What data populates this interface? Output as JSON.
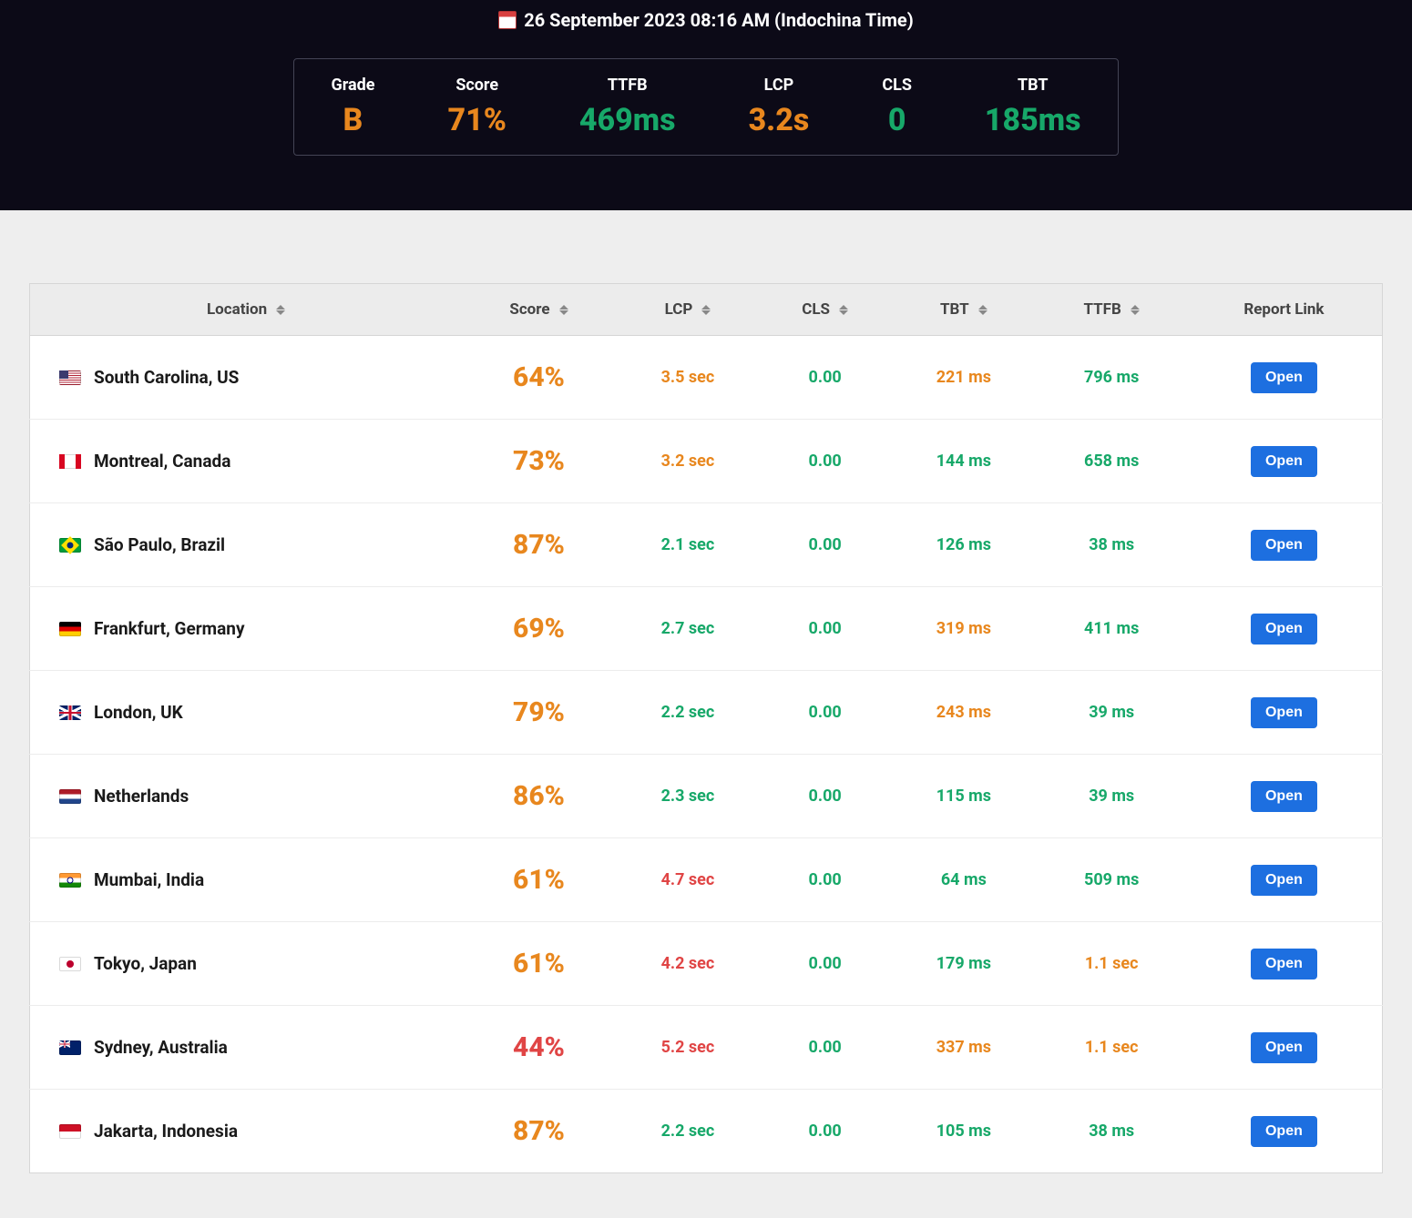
{
  "header": {
    "timestamp": "26 September 2023 08:16 AM (Indochina Time)"
  },
  "summary": {
    "labels": [
      "Grade",
      "Score",
      "TTFB",
      "LCP",
      "CLS",
      "TBT"
    ],
    "values": [
      "B",
      "71%",
      "469ms",
      "3.2s",
      "0",
      "185ms"
    ],
    "value_colors": [
      "amber",
      "amber",
      "green",
      "amber",
      "green",
      "green"
    ]
  },
  "table": {
    "columns": [
      "Location",
      "Score",
      "LCP",
      "CLS",
      "TBT",
      "TTFB",
      "Report Link"
    ],
    "sortable": [
      true,
      true,
      true,
      true,
      true,
      true,
      false
    ],
    "open_label": "Open",
    "rows": [
      {
        "flag": "us",
        "location": "South Carolina, US",
        "score": "64%",
        "score_color": "amber",
        "lcp": "3.5 sec",
        "lcp_color": "amber",
        "cls": "0.00",
        "cls_color": "green",
        "tbt": "221 ms",
        "tbt_color": "amber",
        "ttfb": "796 ms",
        "ttfb_color": "green"
      },
      {
        "flag": "ca",
        "location": "Montreal, Canada",
        "score": "73%",
        "score_color": "amber",
        "lcp": "3.2 sec",
        "lcp_color": "amber",
        "cls": "0.00",
        "cls_color": "green",
        "tbt": "144 ms",
        "tbt_color": "green",
        "ttfb": "658 ms",
        "ttfb_color": "green"
      },
      {
        "flag": "br",
        "location": "São Paulo, Brazil",
        "score": "87%",
        "score_color": "amber",
        "lcp": "2.1 sec",
        "lcp_color": "green",
        "cls": "0.00",
        "cls_color": "green",
        "tbt": "126 ms",
        "tbt_color": "green",
        "ttfb": "38 ms",
        "ttfb_color": "green"
      },
      {
        "flag": "de",
        "location": "Frankfurt, Germany",
        "score": "69%",
        "score_color": "amber",
        "lcp": "2.7 sec",
        "lcp_color": "green",
        "cls": "0.00",
        "cls_color": "green",
        "tbt": "319 ms",
        "tbt_color": "amber",
        "ttfb": "411 ms",
        "ttfb_color": "green"
      },
      {
        "flag": "gb",
        "location": "London, UK",
        "score": "79%",
        "score_color": "amber",
        "lcp": "2.2 sec",
        "lcp_color": "green",
        "cls": "0.00",
        "cls_color": "green",
        "tbt": "243 ms",
        "tbt_color": "amber",
        "ttfb": "39 ms",
        "ttfb_color": "green"
      },
      {
        "flag": "nl",
        "location": "Netherlands",
        "score": "86%",
        "score_color": "amber",
        "lcp": "2.3 sec",
        "lcp_color": "green",
        "cls": "0.00",
        "cls_color": "green",
        "tbt": "115 ms",
        "tbt_color": "green",
        "ttfb": "39 ms",
        "ttfb_color": "green"
      },
      {
        "flag": "in",
        "location": "Mumbai, India",
        "score": "61%",
        "score_color": "amber",
        "lcp": "4.7 sec",
        "lcp_color": "red",
        "cls": "0.00",
        "cls_color": "green",
        "tbt": "64 ms",
        "tbt_color": "green",
        "ttfb": "509 ms",
        "ttfb_color": "green"
      },
      {
        "flag": "jp",
        "location": "Tokyo, Japan",
        "score": "61%",
        "score_color": "amber",
        "lcp": "4.2 sec",
        "lcp_color": "red",
        "cls": "0.00",
        "cls_color": "green",
        "tbt": "179 ms",
        "tbt_color": "green",
        "ttfb": "1.1 sec",
        "ttfb_color": "amber"
      },
      {
        "flag": "au",
        "location": "Sydney, Australia",
        "score": "44%",
        "score_color": "red",
        "lcp": "5.2 sec",
        "lcp_color": "red",
        "cls": "0.00",
        "cls_color": "green",
        "tbt": "337 ms",
        "tbt_color": "amber",
        "ttfb": "1.1 sec",
        "ttfb_color": "amber"
      },
      {
        "flag": "id",
        "location": "Jakarta, Indonesia",
        "score": "87%",
        "score_color": "amber",
        "lcp": "2.2 sec",
        "lcp_color": "green",
        "cls": "0.00",
        "cls_color": "green",
        "tbt": "105 ms",
        "tbt_color": "green",
        "ttfb": "38 ms",
        "ttfb_color": "green"
      }
    ]
  }
}
